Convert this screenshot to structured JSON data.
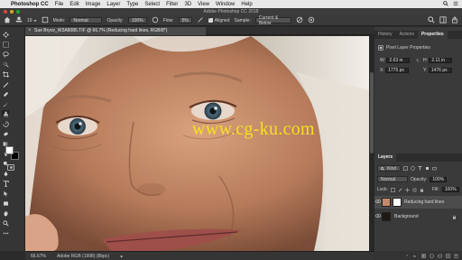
{
  "menubar": {
    "app_name": "Photoshop CC",
    "items": [
      "File",
      "Edit",
      "Image",
      "Layer",
      "Type",
      "Select",
      "Filter",
      "3D",
      "View",
      "Window",
      "Help"
    ]
  },
  "titlebar": {
    "title": "Adobe Photoshop CC 2018"
  },
  "options": {
    "mode_label": "Mode:",
    "mode_value": "Normal",
    "opacity_label": "Opacity:",
    "opacity_value": "100%",
    "flow_label": "Flow:",
    "flow_value": "5%",
    "aligned_label": "Aligned",
    "sample_label": "Sample:",
    "sample_value": "Current & Below"
  },
  "document": {
    "tab_title": "Sue Bryce_W3A8085.TIF @ 66.7% (Reducing hard lines, RGB/8*)",
    "watermark": "www.cg-ku.com"
  },
  "status": {
    "zoom": "66.67%",
    "profile": "Adobe RGB (1998) (8bpc)"
  },
  "panels": {
    "top_tabs": [
      "History",
      "Actions",
      "Properties"
    ],
    "properties": {
      "title": "Pixel Layer Properties",
      "w_label": "W:",
      "w_value": "2.63 in",
      "h_label": "H:",
      "h_value": "2.11 in",
      "x_label": "X:",
      "x_value": "1775 px",
      "y_label": "Y:",
      "y_value": "1476 px",
      "go_label": "GO"
    },
    "layers_tab": "Layers",
    "kind_label": "Kind",
    "blend_mode": "Normal",
    "opacity_label": "Opacity:",
    "opacity_value": "100%",
    "lock_label": "Lock:",
    "fill_label": "Fill:",
    "fill_value": "100%",
    "layers": [
      {
        "name": "Reducing hard lines",
        "selected": true
      },
      {
        "name": "Background",
        "selected": false
      }
    ]
  },
  "colors": {
    "accent_watermark": "#f5e11f",
    "foreground": "#ffffff",
    "background": "#000000"
  }
}
